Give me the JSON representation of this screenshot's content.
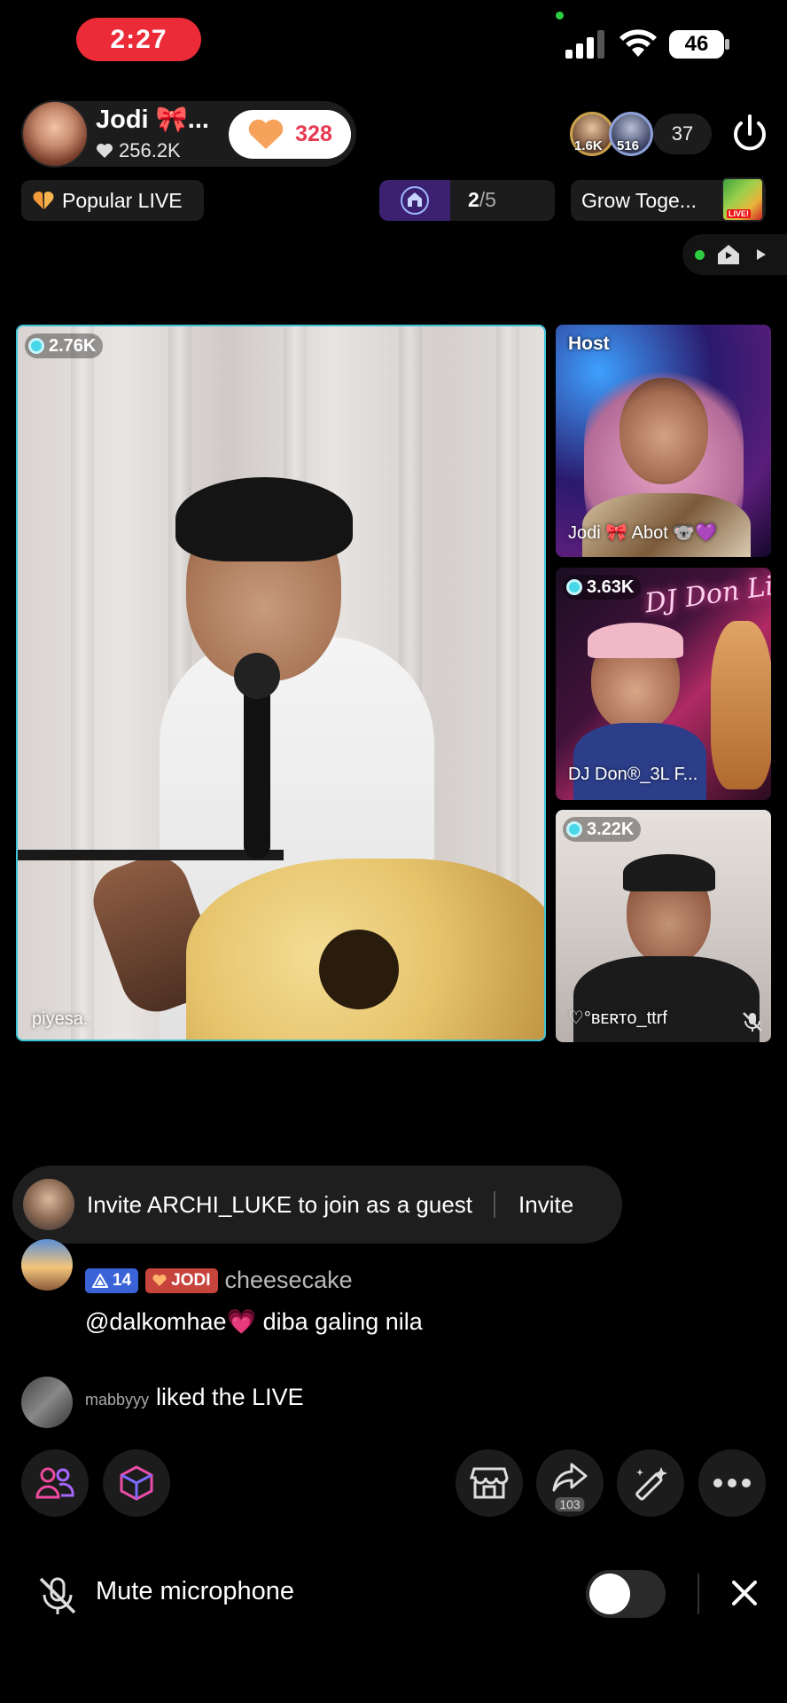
{
  "status_bar": {
    "time": "2:27",
    "battery": "46"
  },
  "host": {
    "name": "Jodi 🎀...",
    "likes": "256.2K",
    "follow_count": "328"
  },
  "viewers": {
    "count": "37",
    "top1_label": "1.6K",
    "top2_label": "516"
  },
  "pills": {
    "popular": "Popular LIVE",
    "rank_current": "2",
    "rank_total": "/5",
    "grow": "Grow Toge...",
    "grow_badge": "LIVE!"
  },
  "main_guest": {
    "viewers": "2.76K",
    "name": "piyesa."
  },
  "side_tiles": [
    {
      "label": "Host",
      "name": "Jodi 🎀 Abot 🐨💜"
    },
    {
      "viewers": "3.63K",
      "name": "DJ Don®_3L F...",
      "sign": "DJ Don Live!"
    },
    {
      "viewers": "3.22K",
      "name": "♡°ʙᴇʀᴛᴏ_ttrf"
    }
  ],
  "invite": {
    "text": "Invite ARCHI_LUKE to join as a guest",
    "button": "Invite"
  },
  "chat": [
    {
      "level": "14",
      "fan_badge": "JODI",
      "user": "cheesecake",
      "message": "@dalkomhae💗 diba galing nila"
    },
    {
      "user": "mabbyyy",
      "message": "liked the LIVE"
    }
  ],
  "tools": {
    "share_count": "103"
  },
  "mute": {
    "label": "Mute microphone",
    "enabled": false
  },
  "colors": {
    "accent": "#3ec3d5",
    "time_pill": "#ec2b39",
    "like": "#e83a52"
  }
}
